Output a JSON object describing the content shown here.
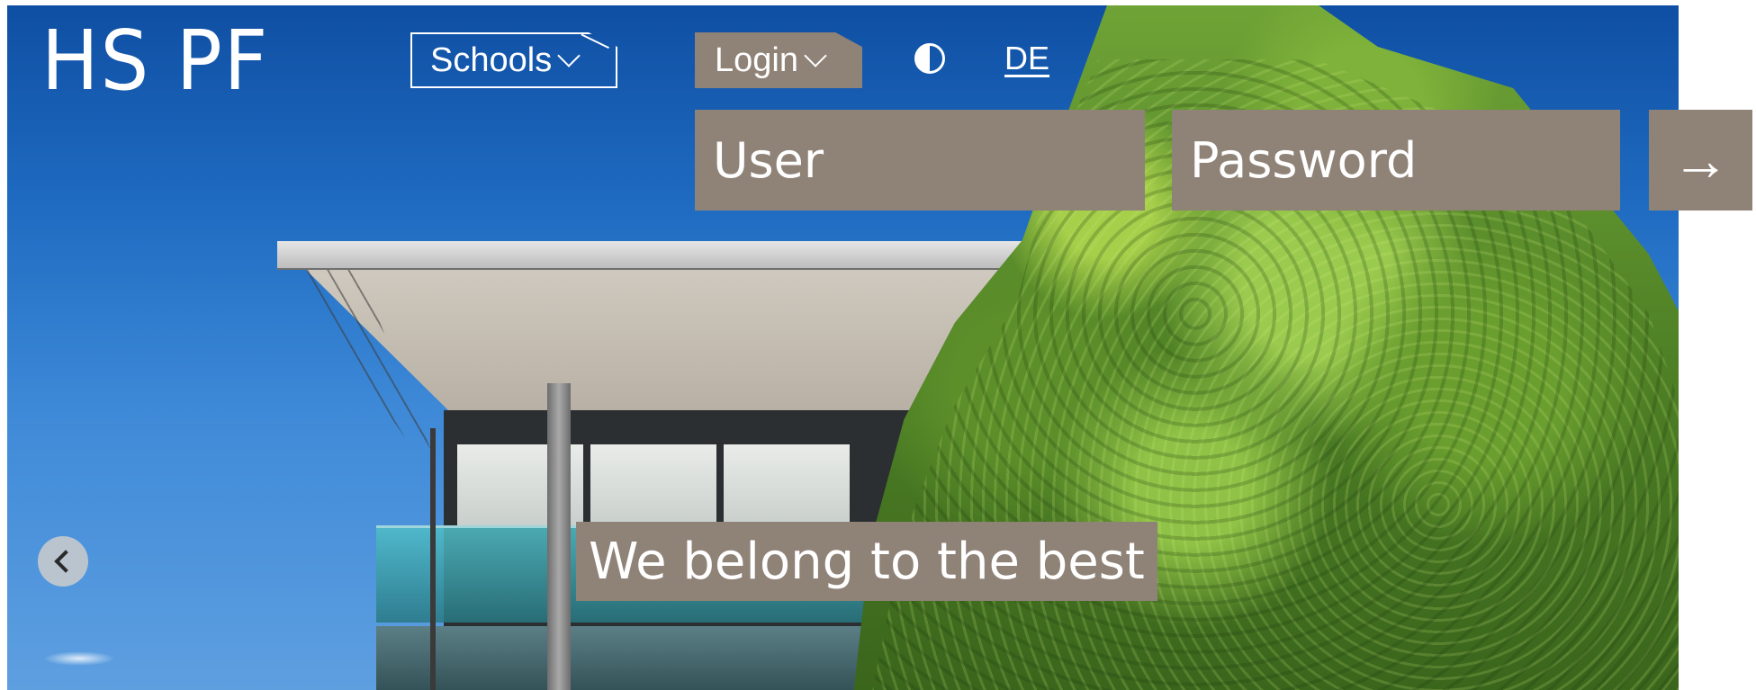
{
  "header": {
    "logo_text": "HS PF",
    "schools_label": "Schools",
    "login_label": "Login",
    "contrast_icon": "contrast-icon",
    "language_label": "DE"
  },
  "login_form": {
    "user_placeholder": "User",
    "password_placeholder": "Password",
    "submit_icon": "→"
  },
  "hero": {
    "caption": "We belong to the best",
    "prev_icon": "chevron-left-icon"
  },
  "colors": {
    "accent_brown": "#8f8277",
    "text_white": "#ffffff"
  }
}
